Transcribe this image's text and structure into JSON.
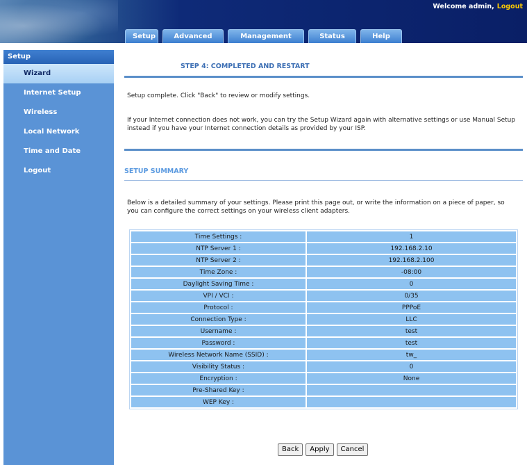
{
  "header": {
    "welcome_text": "Welcome admin,",
    "logout_link": "Logout"
  },
  "tabs": [
    "Setup",
    "Advanced",
    "Management",
    "Status",
    "Help"
  ],
  "sidebar": {
    "title": "Setup",
    "items": [
      "Wizard",
      "Internet Setup",
      "Wireless",
      "Local Network",
      "Time and Date",
      "Logout"
    ],
    "active_index": 0
  },
  "main": {
    "step_title": "STEP 4: COMPLETED AND RESTART",
    "complete_text": "Setup complete. Click \"Back\" to review or modify settings.",
    "help_text": "If your Internet connection does not work, you can try the Setup Wizard again with alternative settings or use Manual Setup instead if you have your Internet connection details as provided by your ISP.",
    "summary_title": "SETUP SUMMARY",
    "summary_text": "Below is a detailed summary of your settings. Please print this page out, or write the information on a piece of paper, so you can configure the correct settings on your wireless client adapters."
  },
  "summary_rows": [
    {
      "label": "Time Settings :",
      "value": "1"
    },
    {
      "label": "NTP Server 1 :",
      "value": "192.168.2.10"
    },
    {
      "label": "NTP Server 2 :",
      "value": "192.168.2.100"
    },
    {
      "label": "Time Zone :",
      "value": "-08:00"
    },
    {
      "label": "Daylight Saving Time :",
      "value": "0"
    },
    {
      "label": "VPI / VCI :",
      "value": "0/35"
    },
    {
      "label": "Protocol :",
      "value": "PPPoE"
    },
    {
      "label": "Connection Type :",
      "value": "LLC"
    },
    {
      "label": "Username :",
      "value": "test"
    },
    {
      "label": "Password :",
      "value": "test"
    },
    {
      "label": "Wireless Network Name (SSID) :",
      "value": "tw_"
    },
    {
      "label": "Visibility Status :",
      "value": "0"
    },
    {
      "label": "Encryption :",
      "value": "None"
    },
    {
      "label": "Pre-Shared Key :",
      "value": ""
    },
    {
      "label": "WEP Key :",
      "value": ""
    }
  ],
  "buttons": {
    "back": "Back",
    "apply": "Apply",
    "cancel": "Cancel"
  },
  "colors": {
    "header_dark": "#0a1f66",
    "tab_blue": "#3c7fd0",
    "sidebar_blue": "#5a93d6",
    "table_cell": "#8ec2f0",
    "logout_yellow": "#ffcc00"
  }
}
